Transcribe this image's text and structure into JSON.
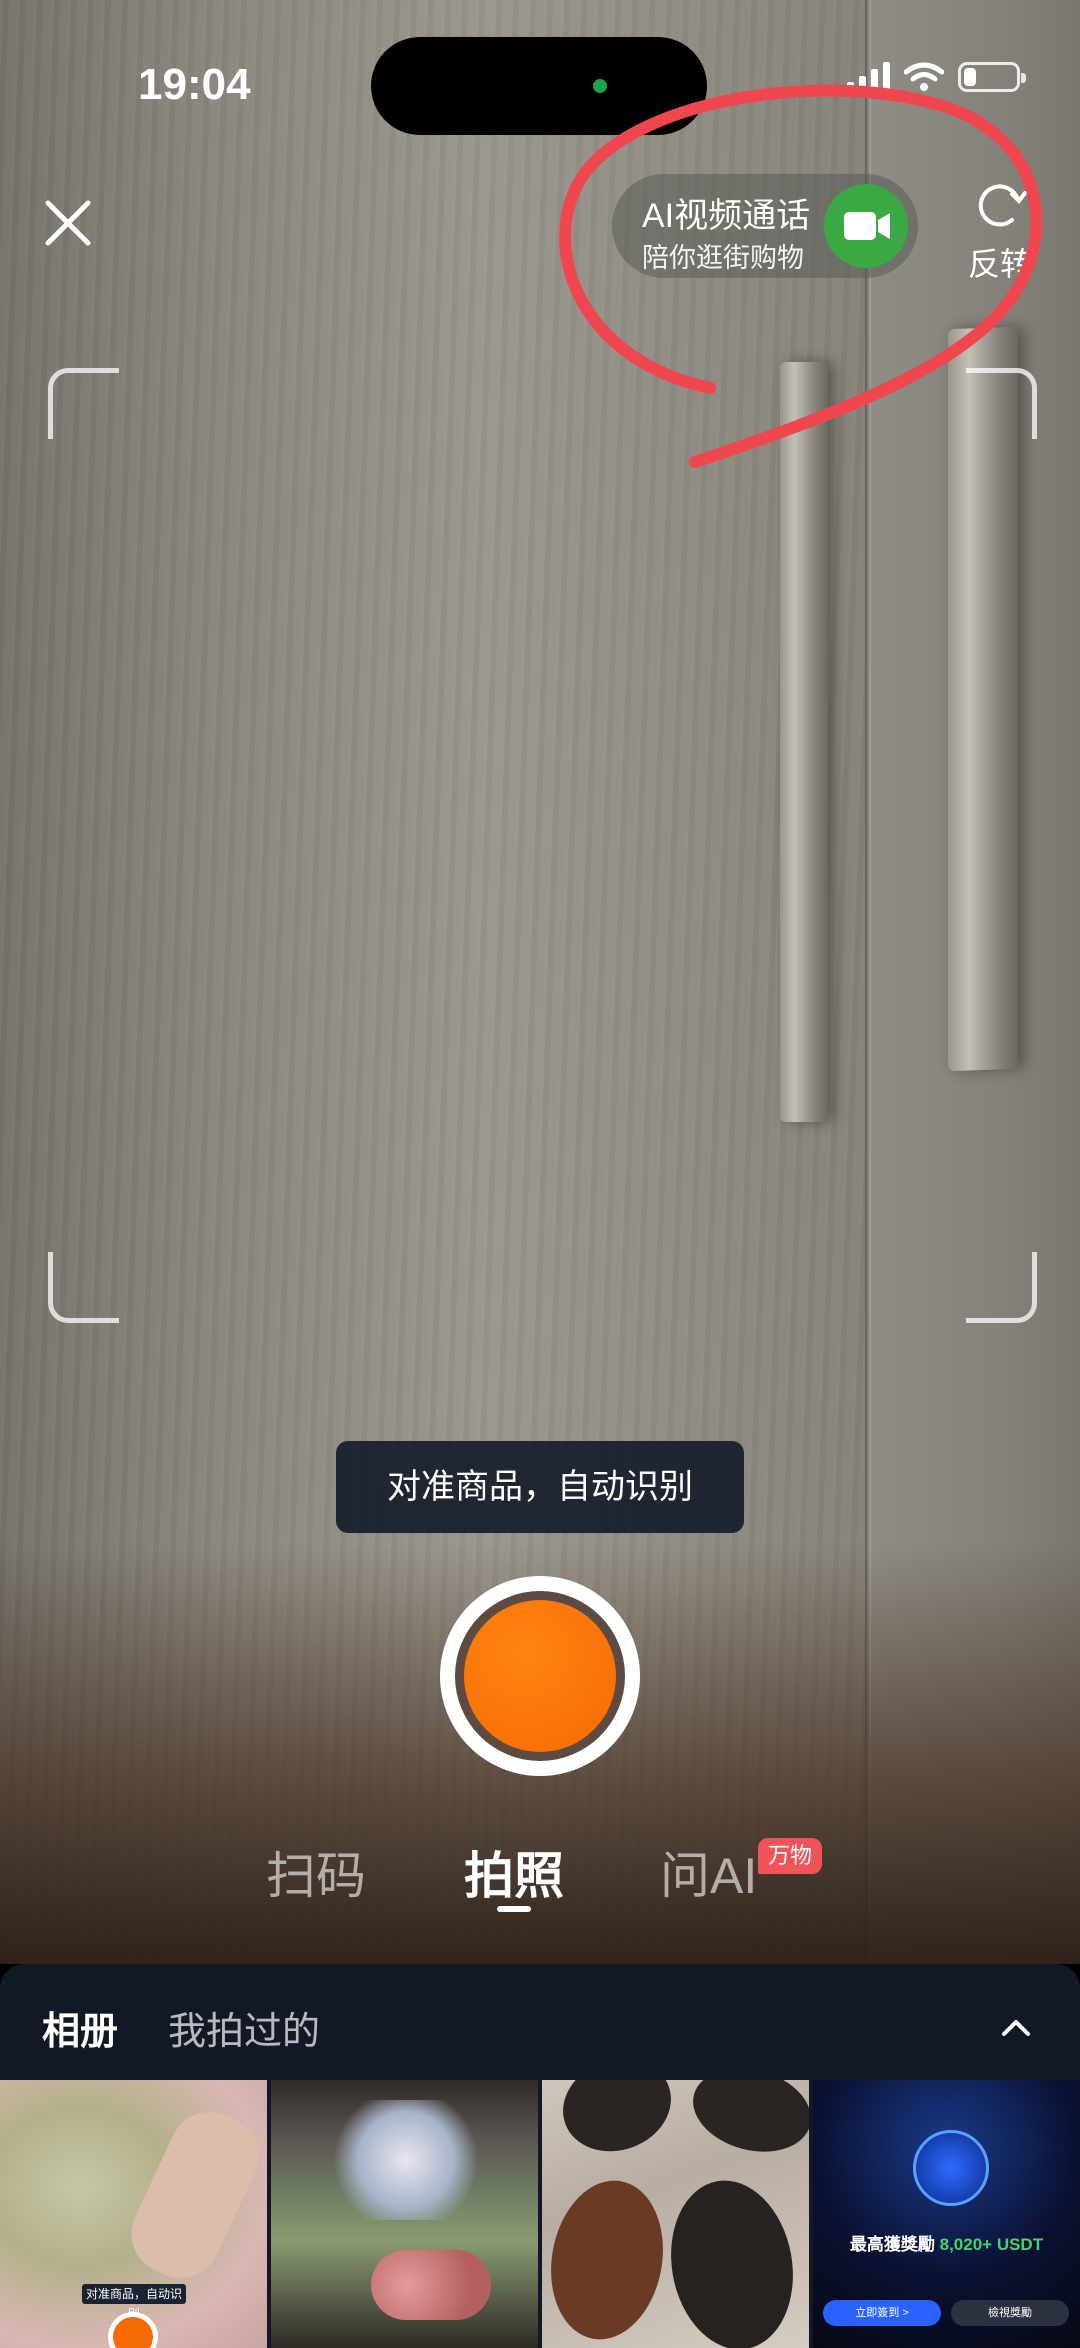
{
  "status_bar": {
    "time": "19:04"
  },
  "top_bar": {
    "ai_call_title": "AI视频通话",
    "ai_call_subtitle": "陪你逛街购物",
    "flip_label": "反转"
  },
  "viewfinder": {
    "hint": "对准商品，自动识别"
  },
  "modes": {
    "scan": "扫码",
    "photo": "拍照",
    "ask_ai": "问AI",
    "ask_ai_badge": "万物",
    "selected": "拍照"
  },
  "album_panel": {
    "tab_album": "相册",
    "tab_mine": "我拍过的",
    "thumbnails": {
      "t1_hint": "对准商品，自动识别",
      "t4_title_prefix": "最高獲獎勵",
      "t4_title_amount": "8,020+ USDT",
      "t4_button_primary": "立即簽到 >",
      "t4_button_secondary": "檢視獎勵"
    }
  },
  "colors": {
    "shutter_orange": "#f56a04",
    "ai_call_green": "#3aa843",
    "badge_red": "#f0545a",
    "annotation_red": "#f0464f",
    "panel_bg": "#131826"
  },
  "icons": {
    "close": "close-icon",
    "flip": "flip-camera-icon",
    "video_call": "video-camera-icon",
    "collapse": "chevron-up-icon"
  }
}
